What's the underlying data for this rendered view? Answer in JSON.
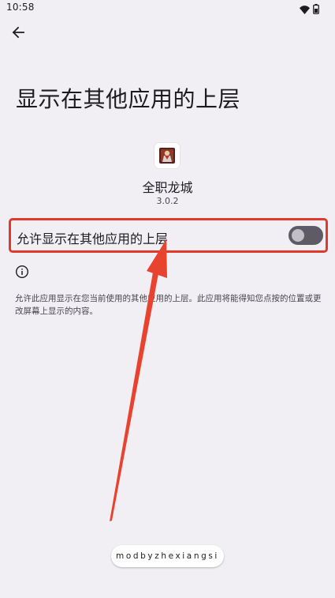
{
  "status_bar": {
    "time": "10:58",
    "icons": [
      "wifi-icon",
      "battery-icon"
    ]
  },
  "header": {
    "back_icon": "arrow-left-icon",
    "title": "显示在其他应用的上层"
  },
  "app": {
    "name": "全职龙城",
    "version": "3.0.2"
  },
  "permission": {
    "label": "允许显示在其他应用的上层",
    "enabled": false
  },
  "info": {
    "icon": "info-icon",
    "text": "允许此应用显示在您当前使用的其他应用的上层。此应用将能得知您点按的位置或更改屏幕上显示的内容。"
  },
  "watermark": "modbyzhexiangsi",
  "colors": {
    "background": "#f2eff4",
    "highlight_border": "#e03a2c",
    "arrow": "#e8432f",
    "toggle_off_track": "#5f5b66"
  }
}
